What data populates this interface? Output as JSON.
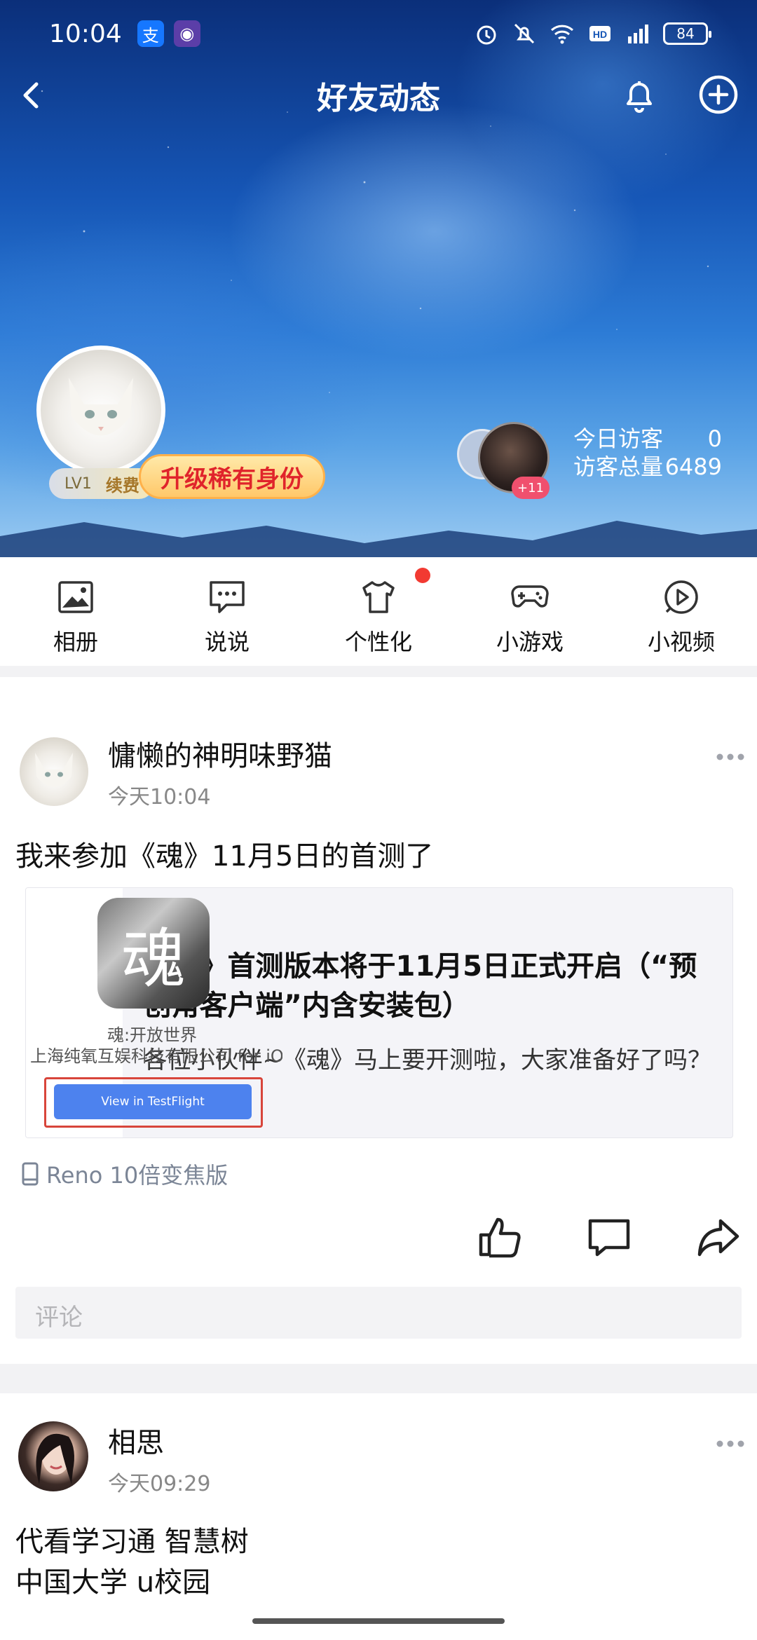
{
  "status_bar": {
    "time": "10:04",
    "battery": "84",
    "network": "4G"
  },
  "nav": {
    "title": "好友动态"
  },
  "profile": {
    "level": "LV1",
    "renew_label": "续费",
    "upgrade_label": "升级稀有身份",
    "visitor_more": "+11"
  },
  "visitors": {
    "today_label": "今日访客",
    "today_value": "0",
    "total_label": "访客总量",
    "total_value": "6489"
  },
  "actions": [
    {
      "label": "相册",
      "icon": "photo-album-icon"
    },
    {
      "label": "说说",
      "icon": "chat-bubble-icon"
    },
    {
      "label": "个性化",
      "icon": "tshirt-icon"
    },
    {
      "label": "小游戏",
      "icon": "gamepad-icon"
    },
    {
      "label": "小视频",
      "icon": "video-play-icon"
    }
  ],
  "posts": [
    {
      "author": "慵懒的神明味野猫",
      "time": "今天10:04",
      "text": "我来参加《魂》11月5日的首测了",
      "card": {
        "thumb_glyph": "魂",
        "thumb_line1": "魂:开放世界",
        "thumb_line2": "上海纯氧互娱科技有限公司 for iOS",
        "thumb_button": "View in TestFlight",
        "title": "《魂》首测版本将于11月5日正式开启（“预创角客户端”内含安装包）",
        "subtitle": "各位小伙伴~《魂》马上要开测啦，大家准备好了吗？"
      },
      "device": "Reno 10倍变焦版",
      "comment_placeholder": "评论"
    },
    {
      "author": "相思",
      "time": "今天09:29",
      "text_line1": "代看学习通 智慧树",
      "text_line2": "中国大学 u校园"
    }
  ]
}
